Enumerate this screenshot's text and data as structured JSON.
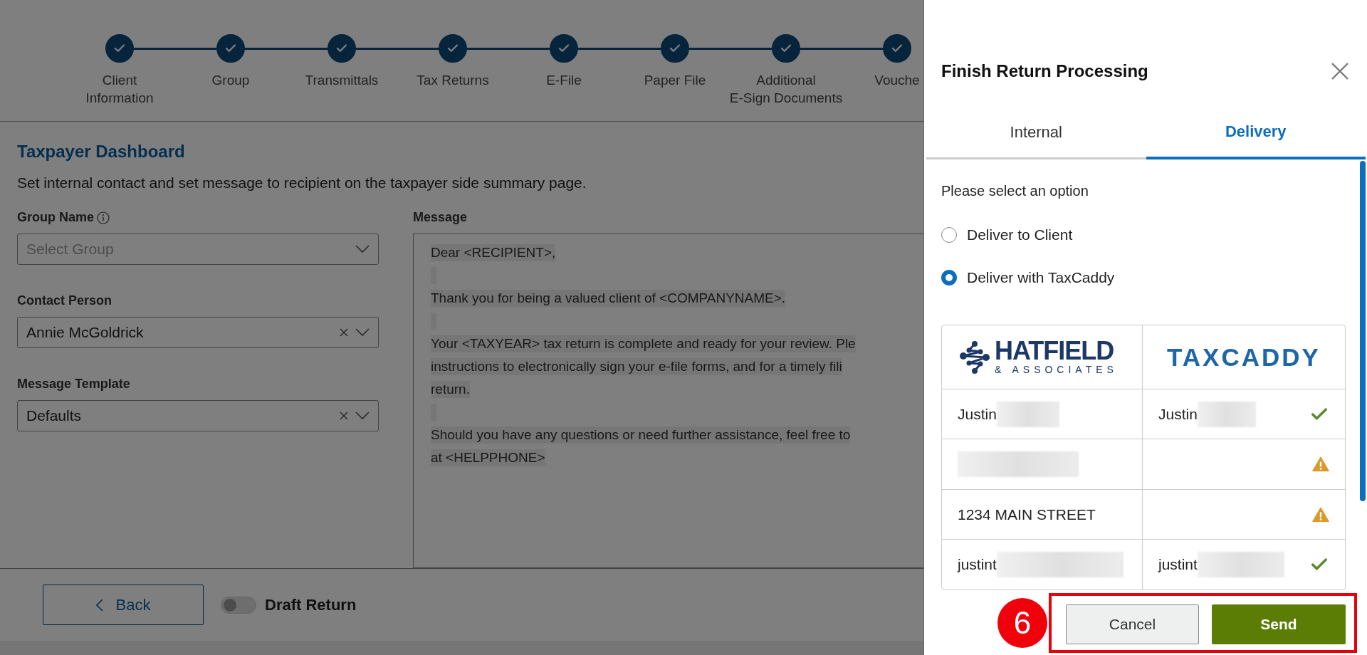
{
  "steps": [
    {
      "label": "Client\nInformation",
      "done": true
    },
    {
      "label": "Group",
      "done": true
    },
    {
      "label": "Transmittals",
      "done": true
    },
    {
      "label": "Tax Returns",
      "done": true
    },
    {
      "label": "E-File",
      "done": true
    },
    {
      "label": "Paper File",
      "done": true
    },
    {
      "label": "Additional\nE-Sign Documents",
      "done": true
    },
    {
      "label": "Vouche",
      "done": true
    }
  ],
  "page": {
    "title": "Taxpayer Dashboard",
    "subtitle": "Set internal contact and set message to recipient on the taxpayer side summary page."
  },
  "fields": [
    {
      "label": "Group Name",
      "info": true,
      "placeholder": "Select Group"
    },
    {
      "label": "Contact Person",
      "value": "Annie McGoldrick",
      "clearable": true
    },
    {
      "label": "Message Template",
      "value": "Defaults",
      "clearable": true
    }
  ],
  "message": {
    "label": "Message",
    "lines": [
      {
        "kind": "text",
        "text": "Dear <RECIPIENT>,"
      },
      {
        "kind": "blank"
      },
      {
        "kind": "text",
        "text": "Thank you for being a valued client of <COMPANYNAME>."
      },
      {
        "kind": "blank"
      },
      {
        "kind": "text",
        "text": "Your <TAXYEAR> tax return is complete and ready for your review. Ple"
      },
      {
        "kind": "text",
        "text": "instructions to electronically sign your e-file forms, and for a timely fili"
      },
      {
        "kind": "text",
        "text": "return."
      },
      {
        "kind": "blank"
      },
      {
        "kind": "text",
        "text": "Should you have any questions or need further assistance, feel free to"
      },
      {
        "kind": "text",
        "text": "at <HELPPHONE>"
      }
    ]
  },
  "footer": {
    "back": "Back",
    "draft": {
      "label": "Draft Return",
      "on": false
    }
  },
  "dialog": {
    "title": "Finish Return Processing",
    "tabs": [
      {
        "label": "Internal",
        "selected": false
      },
      {
        "label": "Delivery",
        "selected": true
      }
    ],
    "prompt": "Please select an option",
    "options": [
      {
        "label": "Deliver to Client",
        "selected": false
      },
      {
        "label": "Deliver with TaxCaddy",
        "selected": true
      }
    ],
    "logos": {
      "firm": "HATFIELD",
      "firm_sub": "& ASSOCIATES",
      "app": "TAXCADDY"
    },
    "rows": [
      {
        "left": {
          "text": "Justin",
          "redacted": true
        },
        "right": {
          "text": "Justin",
          "redacted": true
        },
        "matched": true
      },
      {
        "left": {
          "redacted": true
        },
        "matched": false
      },
      {
        "left": {
          "text": "1234 MAIN STREET"
        },
        "matched": false
      },
      {
        "left": {
          "text": "justint",
          "redacted": true
        },
        "right": {
          "text": "justint",
          "redacted": true
        },
        "matched": true
      }
    ],
    "buttons": [
      {
        "label": "Cancel",
        "kind": "secondary"
      },
      {
        "label": "Send",
        "kind": "primary"
      }
    ],
    "annotation": {
      "number": "6"
    }
  }
}
